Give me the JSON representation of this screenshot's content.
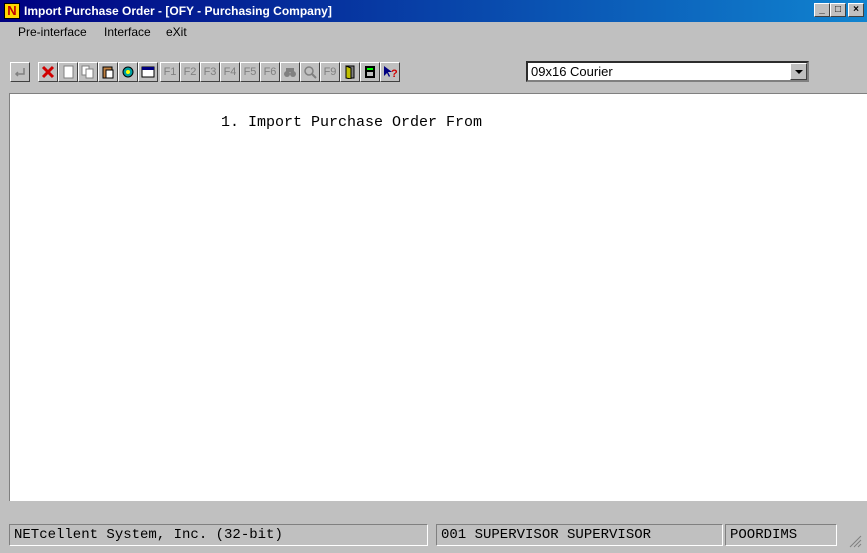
{
  "window": {
    "title": "Import Purchase Order - [OFY - Purchasing Company]",
    "icon_letter": "N",
    "minimize_glyph": "_",
    "maximize_glyph": "□",
    "close_glyph": "×"
  },
  "menubar": {
    "items": [
      "Pre-interface",
      "Interface",
      "eXit"
    ]
  },
  "toolbar": {
    "f1": "F1",
    "f2": "F2",
    "f3": "F3",
    "f4": "F4",
    "f5": "F5",
    "f6": "F6",
    "f9": "F9",
    "font_value": "09x16 Courier"
  },
  "content": {
    "menu_option": "1. Import Purchase Order From"
  },
  "statusbar": {
    "company": "NETcellent System, Inc. (32-bit)",
    "user": "001 SUPERVISOR SUPERVISOR",
    "node": "POORDIMS"
  }
}
